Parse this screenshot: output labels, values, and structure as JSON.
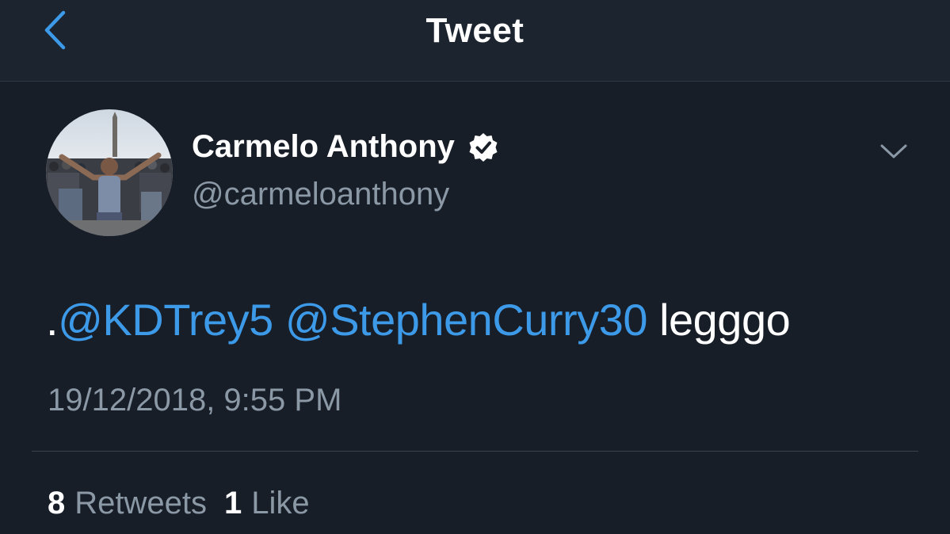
{
  "header": {
    "title": "Tweet",
    "back_icon": "chevron-left-icon"
  },
  "colors": {
    "background": "#181e28",
    "header_background": "#1c2430",
    "accent": "#3d9ae8",
    "muted_text": "#8b98a5",
    "primary_text": "#ffffff"
  },
  "tweet": {
    "author": {
      "name": "Carmelo Anthony",
      "handle": "@carmeloanthony",
      "verified_icon": "verified-badge-icon",
      "avatar_icon": "profile-photo"
    },
    "more_icon": "chevron-down-icon",
    "text": {
      "prefix": ".",
      "mention_1": "@KDTrey5",
      "mention_2": "@StephenCurry30",
      "body": "legggo"
    },
    "timestamp": "19/12/2018, 9:55 PM",
    "stats": {
      "retweets_count": "8",
      "retweets_label": "Retweets",
      "likes_count": "1",
      "likes_label": "Like"
    }
  }
}
